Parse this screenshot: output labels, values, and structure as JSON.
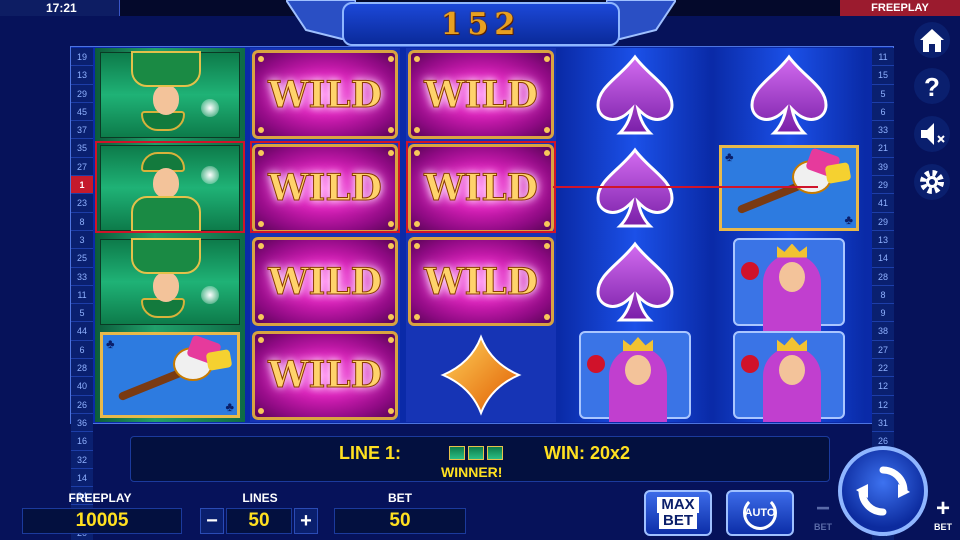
{
  "status_bar": {
    "time": "17:21",
    "mode": "FREEPLAY"
  },
  "header": {
    "counter": "152"
  },
  "paylines_left": [
    "19",
    "13",
    "29",
    "45",
    "37",
    "35",
    "27",
    "1",
    "23",
    "8",
    "3",
    "25",
    "33",
    "11",
    "5",
    "44",
    "6",
    "28",
    "40",
    "26",
    "36",
    "16",
    "32",
    "14",
    "34",
    "10",
    "20"
  ],
  "paylines_right": [
    "11",
    "15",
    "5",
    "6",
    "33",
    "21",
    "39",
    "29",
    "41",
    "29",
    "13",
    "14",
    "28",
    "8",
    "9",
    "38",
    "27",
    "22",
    "12",
    "12",
    "31",
    "26",
    "34",
    "24",
    "17",
    "30",
    "34"
  ],
  "active_payline": "1",
  "reels": [
    [
      "jack",
      "jack",
      "jack",
      "jester"
    ],
    [
      "wild",
      "wild",
      "wild",
      "wild"
    ],
    [
      "wild",
      "wild",
      "wild",
      "diamond"
    ],
    [
      "spade",
      "spade",
      "spade",
      "queen"
    ],
    [
      "spade",
      "jester",
      "queen",
      "queen"
    ]
  ],
  "wild_label": "WILD",
  "win_info": {
    "line_label": "LINE 1:",
    "win_label": "WIN: 20x2",
    "winner_label": "WINNER!"
  },
  "controls": {
    "freeplay_label": "FREEPLAY",
    "freeplay_value": "10005",
    "lines_label": "LINES",
    "lines_value": "50",
    "bet_label": "BET",
    "bet_value": "50",
    "minus": "−",
    "plus": "+",
    "max_bet_label": "MAX\nBET",
    "auto_label": "AUTO",
    "bet_minus_label": "BET",
    "bet_plus_label": "BET"
  },
  "colors": {
    "highlight": "#d0142a",
    "accent_text": "#ffe020",
    "freeplay_badge": "#9b1b2e"
  },
  "icons": [
    "home-icon",
    "help-icon",
    "sound-off-icon",
    "settings-gear-icon",
    "spin-icon",
    "autoplay-icon"
  ]
}
